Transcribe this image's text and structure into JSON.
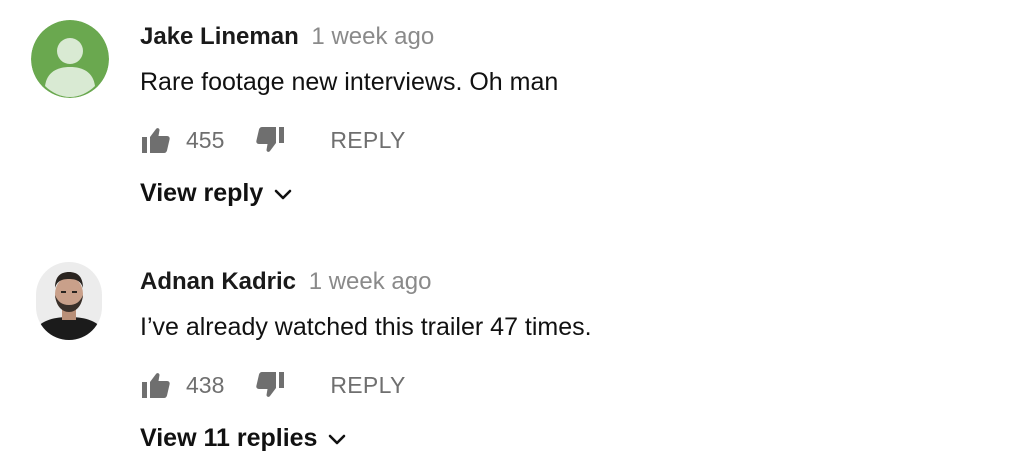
{
  "comments": [
    {
      "author": "Jake Lineman",
      "time": "1 week ago",
      "text": "Rare footage new interviews. Oh man",
      "likes": "455",
      "reply_label": "REPLY",
      "view_replies_label": "View reply",
      "avatar_icon": "default-user-avatar",
      "avatar_color": "#6aa84f"
    },
    {
      "author": "Adnan Kadric",
      "time": "1 week ago",
      "text": "I’ve already watched this trailer 47 times.",
      "likes": "438",
      "reply_label": "REPLY",
      "view_replies_label": "View 11 replies",
      "avatar_icon": "user-photo-avatar"
    }
  ],
  "icons": {
    "like": "thumbs-up-icon",
    "dislike": "thumbs-down-icon",
    "expand": "chevron-down-icon"
  },
  "colors": {
    "text": "#111111",
    "secondary": "#6f6f6f",
    "timestamp": "#8a8a8a"
  }
}
